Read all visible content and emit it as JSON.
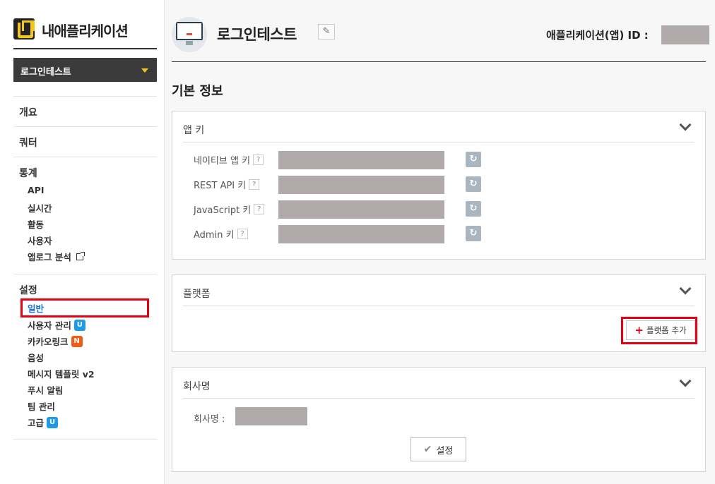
{
  "sidebar": {
    "brand_title": "내애플리케이션",
    "app_select": "로그인테스트",
    "menu": {
      "overview": "개요",
      "query": "쿼터",
      "stats": "통계",
      "stats_items": [
        "API",
        "실시간",
        "활동",
        "사용자",
        "앱로그 분석"
      ],
      "settings": "설정",
      "settings_items": [
        "일반",
        "사용자 관리",
        "카카오링크",
        "음성",
        "메시지 템플릿 v2",
        "푸시 알림",
        "팀 관리",
        "고급"
      ],
      "badge_u": "U",
      "badge_n": "N"
    }
  },
  "header": {
    "app_name": "로그인테스트",
    "edit_icon": "pencil-icon",
    "app_id_label": "애플리케이션(앱) ID :"
  },
  "section_title": "기본 정보",
  "app_keys": {
    "title": "앱 키",
    "help": "?",
    "rows": [
      {
        "label": "네이티브 앱 키"
      },
      {
        "label": "REST API 키"
      },
      {
        "label": "JavaScript 키"
      },
      {
        "label": "Admin 키"
      }
    ],
    "refresh_icon": "refresh-icon"
  },
  "platform": {
    "title": "플랫폼",
    "add_button": "플랫폼 추가"
  },
  "company": {
    "title": "회사명",
    "label": "회사명 :",
    "save_button": "설정"
  },
  "colors": {
    "highlight": "#e60012",
    "active_link": "#1f6fd1",
    "badge_blue": "#1e9be8",
    "badge_orange": "#f25c19",
    "select_bg": "#3b3b3b",
    "redacted": "#b0aaaa"
  }
}
